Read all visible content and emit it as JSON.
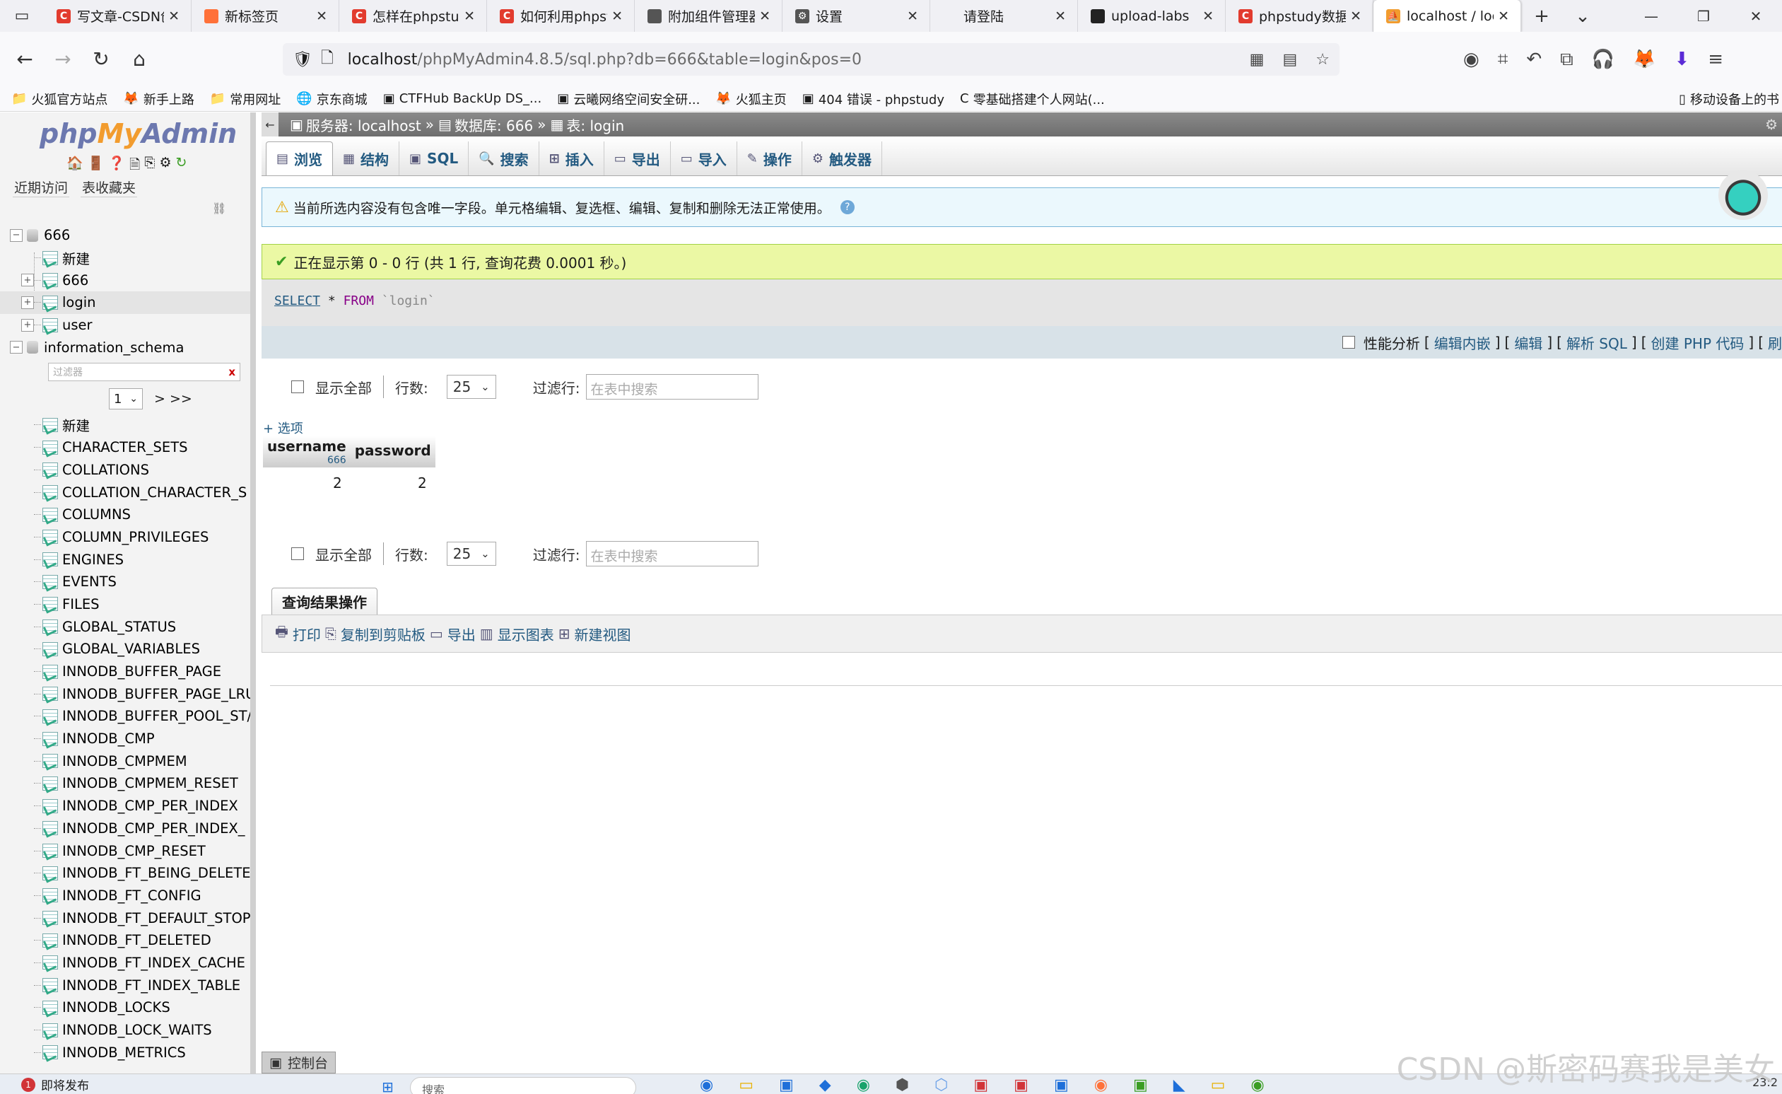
{
  "browser": {
    "tabs": [
      {
        "label": "写文章-CSDN创",
        "fav_color": "#e23b2e",
        "fav_text": "C"
      },
      {
        "label": "新标签页",
        "fav_color": "#ff7139",
        "fav_text": ""
      },
      {
        "label": "怎样在phpstud",
        "fav_color": "#e23b2e",
        "fav_text": "C"
      },
      {
        "label": "如何利用phpst",
        "fav_color": "#e23b2e",
        "fav_text": "C"
      },
      {
        "label": "附加组件管理器",
        "fav_color": "#555555",
        "fav_text": ""
      },
      {
        "label": "设置",
        "fav_color": "#555555",
        "fav_text": "⚙"
      },
      {
        "label": "请登陆",
        "fav_color": "#f0f0f4",
        "fav_text": ""
      },
      {
        "label": "upload-labs",
        "fav_color": "#222222",
        "fav_text": ""
      },
      {
        "label": "phpstudy数据库",
        "fav_color": "#e23b2e",
        "fav_text": "C"
      },
      {
        "label": "localhost / loc",
        "fav_color": "#f29c2e",
        "fav_text": "pma",
        "active": true
      }
    ],
    "url_host": "localhost",
    "url_path": "/phpMyAdmin4.8.5/sql.php?db=666&table=login&pos=0",
    "bookmarks": [
      {
        "icon": "📁",
        "label": "火狐官方站点"
      },
      {
        "icon": "🦊",
        "label": "新手上路"
      },
      {
        "icon": "📁",
        "label": "常用网址"
      },
      {
        "icon": "🌐",
        "label": "京东商城"
      },
      {
        "icon": "▣",
        "label": "CTFHub BackUp DS_..."
      },
      {
        "icon": "▣",
        "label": "云曦网络空间安全研..."
      },
      {
        "icon": "🦊",
        "label": "火狐主页"
      },
      {
        "icon": "▣",
        "label": "404 错误 - phpstudy"
      },
      {
        "icon": "C",
        "label": "零基础搭建个人网站(..."
      }
    ],
    "bookmarks_right": "移动设备上的书"
  },
  "pma": {
    "logo": {
      "php": "php",
      "my": "My",
      "admin": "Admin"
    },
    "left_tabs": [
      "近期访问",
      "表收藏夹"
    ],
    "tree": {
      "db1": "666",
      "db1_items": [
        "新建",
        "666",
        "login",
        "user"
      ],
      "db2": "information_schema",
      "filter_placeholder": "过滤器",
      "filter_clear": "x",
      "page_select": "1",
      "page_next": "> >>",
      "db2_items": [
        "新建",
        "CHARACTER_SETS",
        "COLLATIONS",
        "COLLATION_CHARACTER_S",
        "COLUMNS",
        "COLUMN_PRIVILEGES",
        "ENGINES",
        "EVENTS",
        "FILES",
        "GLOBAL_STATUS",
        "GLOBAL_VARIABLES",
        "INNODB_BUFFER_PAGE",
        "INNODB_BUFFER_PAGE_LRU",
        "INNODB_BUFFER_POOL_ST/",
        "INNODB_CMP",
        "INNODB_CMPMEM",
        "INNODB_CMPMEM_RESET",
        "INNODB_CMP_PER_INDEX",
        "INNODB_CMP_PER_INDEX_",
        "INNODB_CMP_RESET",
        "INNODB_FT_BEING_DELETE",
        "INNODB_FT_CONFIG",
        "INNODB_FT_DEFAULT_STOP",
        "INNODB_FT_DELETED",
        "INNODB_FT_INDEX_CACHE",
        "INNODB_FT_INDEX_TABLE",
        "INNODB_LOCKS",
        "INNODB_LOCK_WAITS",
        "INNODB_METRICS"
      ]
    },
    "breadcrumb": {
      "server": "服务器: localhost",
      "db": "数据库: 666",
      "table": "表: login",
      "sep": "»"
    },
    "menu": [
      {
        "label": "浏览",
        "icon": "▤"
      },
      {
        "label": "结构",
        "icon": "▦"
      },
      {
        "label": "SQL",
        "icon": "▣"
      },
      {
        "label": "搜索",
        "icon": "🔍"
      },
      {
        "label": "插入",
        "icon": "⊞"
      },
      {
        "label": "导出",
        "icon": "▭"
      },
      {
        "label": "导入",
        "icon": "▭"
      },
      {
        "label": "操作",
        "icon": "✎"
      },
      {
        "label": "触发器",
        "icon": "⚙"
      }
    ],
    "notice": "当前所选内容没有包含唯一字段。单元格编辑、复选框、编辑、复制和删除无法正常使用。",
    "success": "正在显示第 0 - 0 行 (共 1 行, 查询花费 0.0001 秒。)",
    "sql": {
      "kw": "SELECT",
      "star": "*",
      "from": "FROM",
      "table": "`login`"
    },
    "sqltools": {
      "profiling": "性能分析",
      "links": [
        "编辑内嵌",
        "编辑",
        "解析 SQL",
        "创建 PHP 代码",
        "刷"
      ]
    },
    "nav": {
      "show_all": "显示全部",
      "rows_label": "行数:",
      "rows_value": "25",
      "filter_label": "过滤行:",
      "filter_placeholder": "在表中搜索"
    },
    "options": "+ 选项",
    "table": {
      "headers": [
        {
          "name": "username",
          "sub": "666"
        },
        {
          "name": "password",
          "sub": ""
        }
      ],
      "rows": [
        [
          "2",
          "2"
        ]
      ]
    },
    "qro_title": "查询结果操作",
    "qro_links": [
      {
        "icon": "🖶",
        "label": "打印"
      },
      {
        "icon": "⎘",
        "label": "复制到剪贴板"
      },
      {
        "icon": "▭",
        "label": "导出"
      },
      {
        "icon": "▥",
        "label": "显示图表"
      },
      {
        "icon": "⊞",
        "label": "新建视图"
      }
    ],
    "console": "控制台"
  },
  "taskbar": {
    "news": "即将发布",
    "news_badge": "1",
    "search": "搜索",
    "clock": "23:2"
  },
  "watermark": "CSDN @斯密码赛我是美女"
}
